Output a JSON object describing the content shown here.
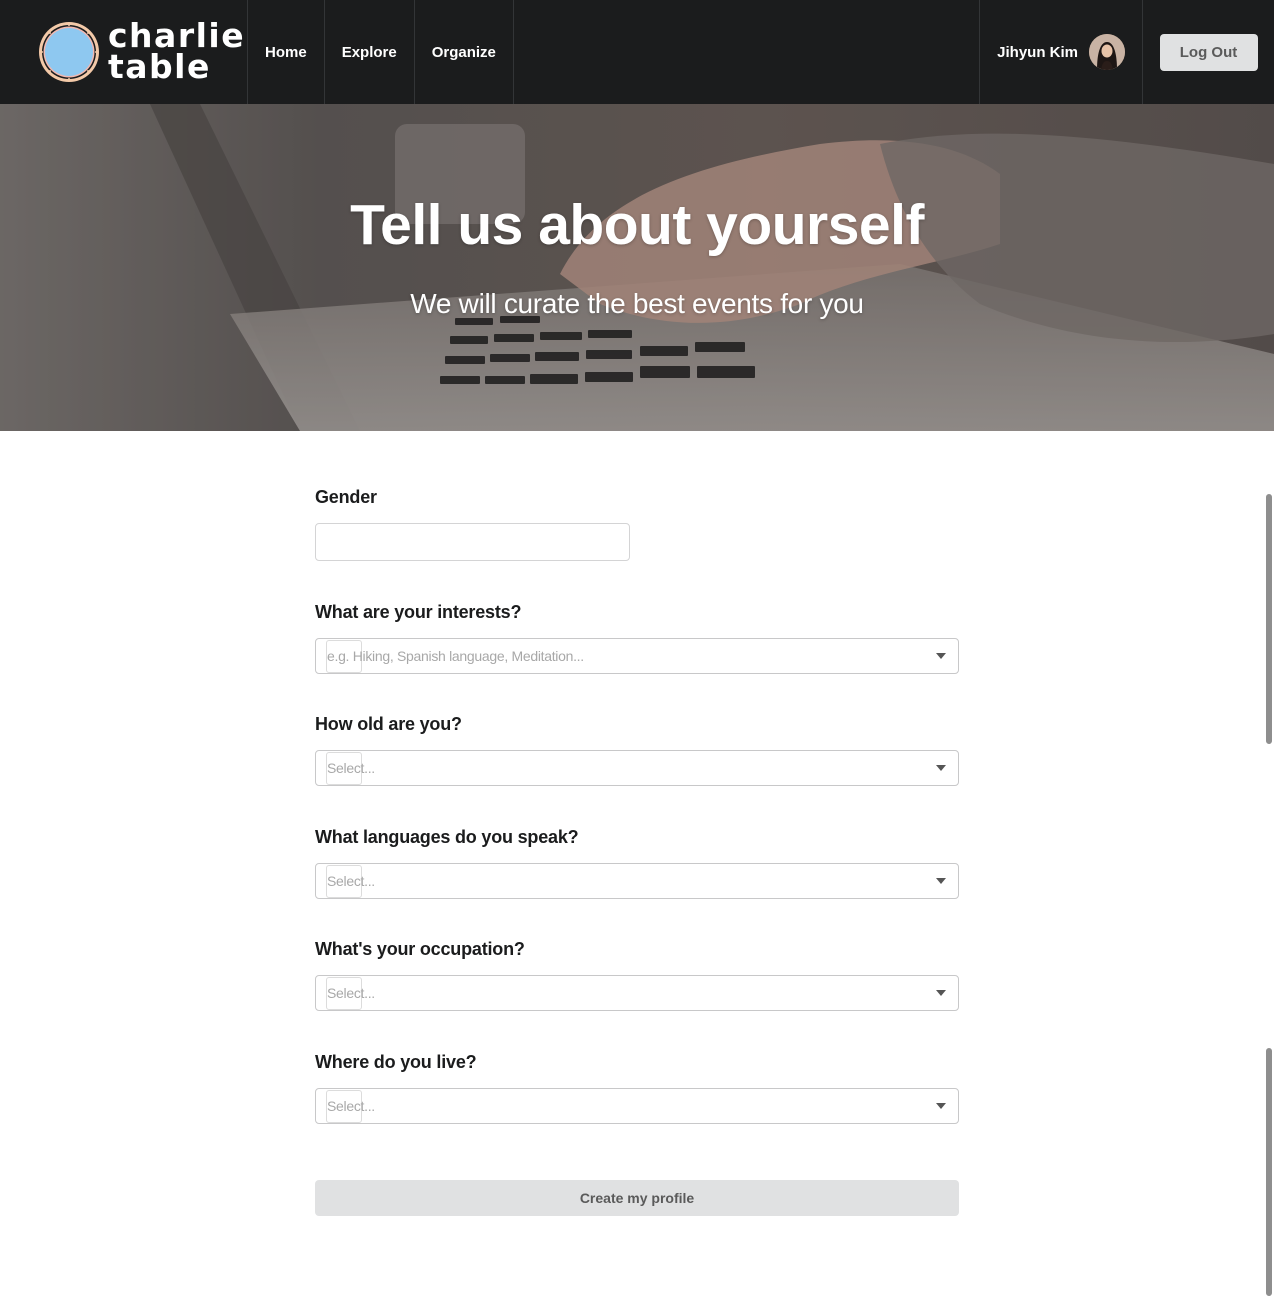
{
  "brand": {
    "line1": "charlie",
    "line2": "table"
  },
  "nav": {
    "items": [
      {
        "label": "Home"
      },
      {
        "label": "Explore"
      },
      {
        "label": "Organize"
      }
    ],
    "user_name": "Jihyun Kim",
    "logout_label": "Log Out"
  },
  "hero": {
    "title": "Tell us about yourself",
    "subtitle": "We will curate the best events for you"
  },
  "form": {
    "gender": {
      "label": "Gender",
      "value": ""
    },
    "interests": {
      "label": "What are your interests?",
      "placeholder": "e.g. Hiking, Spanish language, Meditation..."
    },
    "age": {
      "label": "How old are you?",
      "placeholder": "Select..."
    },
    "languages": {
      "label": "What languages do you speak?",
      "placeholder": "Select..."
    },
    "occupation": {
      "label": "What's your occupation?",
      "placeholder": "Select..."
    },
    "location": {
      "label": "Where do you live?",
      "placeholder": "Select..."
    },
    "submit_label": "Create my profile"
  },
  "colors": {
    "nav_background": "#1b1c1d",
    "button_background": "#e0e1e2",
    "logo_circle": "#8ec8f0",
    "logo_ring": "#f3c9a8"
  }
}
